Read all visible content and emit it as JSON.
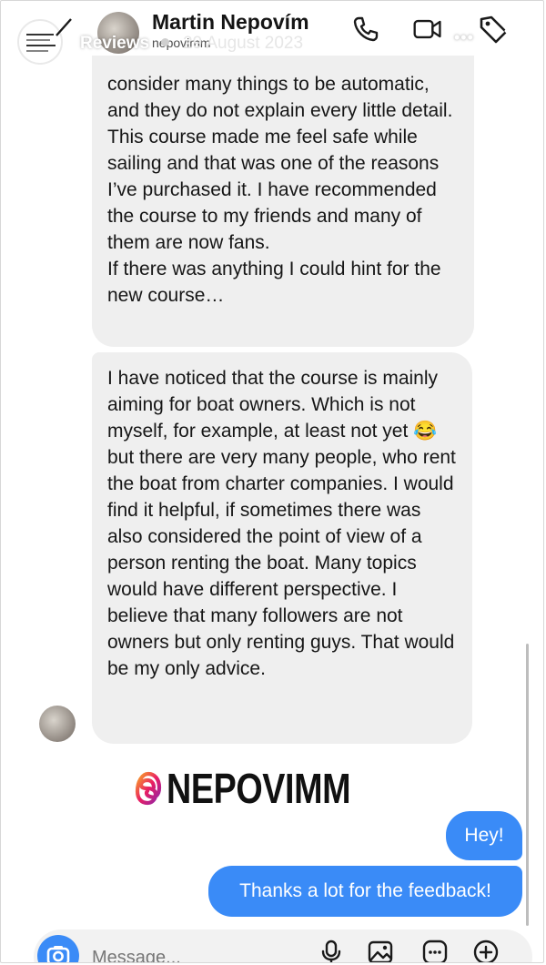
{
  "story": {
    "title": "Reviews",
    "date": "29 August 2023"
  },
  "chat": {
    "contact_name": "Martin Nepovím",
    "contact_handle": "nepovimm"
  },
  "messages": {
    "incoming": [
      [
        "consider many things to be automatic, and they do not explain every little detail. This course made me feel safe while sailing and that was one of the reasons I’ve purchased it. I have recommended the course to my friends and many of them are now fans.",
        "If there was anything I could hint for the new course…"
      ],
      [
        "I have noticed that the course is mainly aiming for boat owners. Which is not myself, for example, at least not yet 😂 but there are very many people, who rent the boat from charter companies. I would find it helpful, if sometimes there was also considered the point of view of a person renting the boat. Many topics would have different perspective. I believe that many followers are not owners but only renting guys. That would be my only advice."
      ]
    ],
    "outgoing": [
      "Hey!",
      "Thanks a lot for the feedback!"
    ]
  },
  "sticker": {
    "text": "NEPOVIMM"
  },
  "composer": {
    "placeholder": "Message..."
  },
  "icons": {
    "back": "chevron-left-icon",
    "call": "phone-icon",
    "video": "video-camera-icon",
    "more": "more-icon",
    "tag": "tag-icon",
    "close": "close-icon",
    "camera": "camera-icon",
    "mic": "microphone-icon",
    "gallery": "gallery-icon",
    "sticker": "sticker-icon",
    "add": "plus-icon",
    "threads": "threads-logo-icon"
  },
  "colors": {
    "incoming_bubble": "#efefef",
    "outgoing_bubble": "#3a8bf7",
    "camera_button": "#3a8bf7"
  }
}
